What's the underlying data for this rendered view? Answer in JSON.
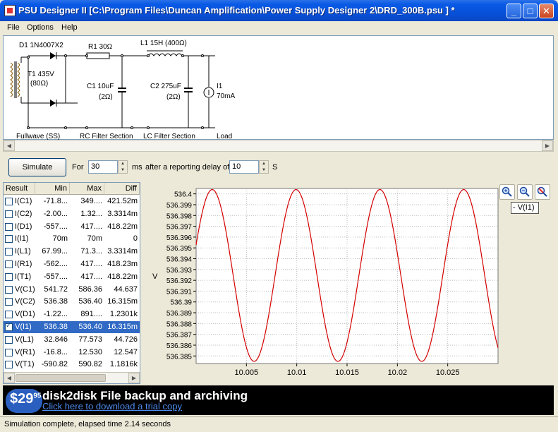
{
  "window": {
    "title": "PSU Designer II  [C:\\Program Files\\Duncan Amplification\\Power Supply Designer 2\\DRD_300B.psu ] *",
    "controls": {
      "minimize": "_",
      "maximize": "□",
      "close": "✕"
    }
  },
  "menu": {
    "file": "File",
    "options": "Options",
    "help": "Help"
  },
  "circuit": {
    "d1": "D1 1N4007X2",
    "t1_name": "T1 435V",
    "t1_res": "(80Ω)",
    "r1": "R1 30Ω",
    "l1": "L1 15H (400Ω)",
    "c1_name": "C1 10uF",
    "c1_res": "(2Ω)",
    "c2_name": "C2 275uF",
    "c2_res": "(2Ω)",
    "i1_name": "I1",
    "i1_val": "70mA",
    "section_rect": "Fullwave (SS)",
    "section_rc": "RC Filter Section",
    "section_lc": "LC Filter Section",
    "section_load": "Load"
  },
  "simulate": {
    "button": "Simulate",
    "for_label": "For",
    "for_value": "30",
    "ms_label": "ms",
    "delay_label": "after a reporting delay of",
    "delay_value": "10",
    "s_label": "S"
  },
  "results": {
    "headers": [
      "Result",
      "Min",
      "Max",
      "Diff"
    ],
    "rows": [
      [
        "I(C1)",
        "-71.8...",
        "349....",
        "421.52m"
      ],
      [
        "I(C2)",
        "-2.00...",
        "1.32...",
        "3.3314m"
      ],
      [
        "I(D1)",
        "-557....",
        "417....",
        "418.22m"
      ],
      [
        "I(I1)",
        "70m",
        "70m",
        "0"
      ],
      [
        "I(L1)",
        "67.99...",
        "71.3...",
        "3.3314m"
      ],
      [
        "I(R1)",
        "-562....",
        "417....",
        "418.23m"
      ],
      [
        "I(T1)",
        "-557....",
        "417....",
        "418.22m"
      ],
      [
        "V(C1)",
        "541.72",
        "586.36",
        "44.637"
      ],
      [
        "V(C2)",
        "536.38",
        "536.40",
        "16.315m"
      ],
      [
        "V(D1)",
        "-1.22...",
        "891....",
        "1.2301k"
      ],
      [
        "V(I1)",
        "536.38",
        "536.40",
        "16.315m"
      ],
      [
        "V(L1)",
        "32.846",
        "77.573",
        "44.726"
      ],
      [
        "V(R1)",
        "-16.8...",
        "12.530",
        "12.547"
      ],
      [
        "V(T1)",
        "-590.82",
        "590.82",
        "1.1816k"
      ]
    ],
    "selected_index": 10
  },
  "graph": {
    "legend": "- V(I1)",
    "zoom_icons": [
      "zoom-in-icon",
      "zoom-out-icon",
      "zoom-reset-icon"
    ]
  },
  "chart_data": {
    "type": "line",
    "ylabel": "V",
    "xlabel": "",
    "xlim": [
      10.0,
      10.03
    ],
    "ylim": [
      536.3843,
      536.4005
    ],
    "yticks": [
      "536.4",
      "536.399",
      "536.398",
      "536.397",
      "536.396",
      "536.395",
      "536.394",
      "536.393",
      "536.392",
      "536.391",
      "536.39",
      "536.389",
      "536.388",
      "536.387",
      "536.386",
      "536.385"
    ],
    "ytick_values": [
      536.4,
      536.399,
      536.398,
      536.397,
      536.396,
      536.395,
      536.394,
      536.393,
      536.392,
      536.391,
      536.39,
      536.389,
      536.388,
      536.387,
      536.386,
      536.385
    ],
    "xticks": [
      "10.005",
      "10.01",
      "10.015",
      "10.02",
      "10.025"
    ],
    "xtick_values": [
      10.005,
      10.01,
      10.015,
      10.02,
      10.025
    ],
    "series": [
      {
        "name": "V(I1)",
        "color": "#d40000",
        "min": 536.3845,
        "max": 536.4004,
        "period": 0.00833,
        "first_peak": 10.0016
      }
    ],
    "grid": true
  },
  "banner": {
    "price": "$29",
    "cents": "95",
    "title": "disk2disk File backup and archiving",
    "link": "Click here to download a trial copy"
  },
  "status": {
    "text": "Simulation complete, elapsed time 2.14 seconds"
  }
}
